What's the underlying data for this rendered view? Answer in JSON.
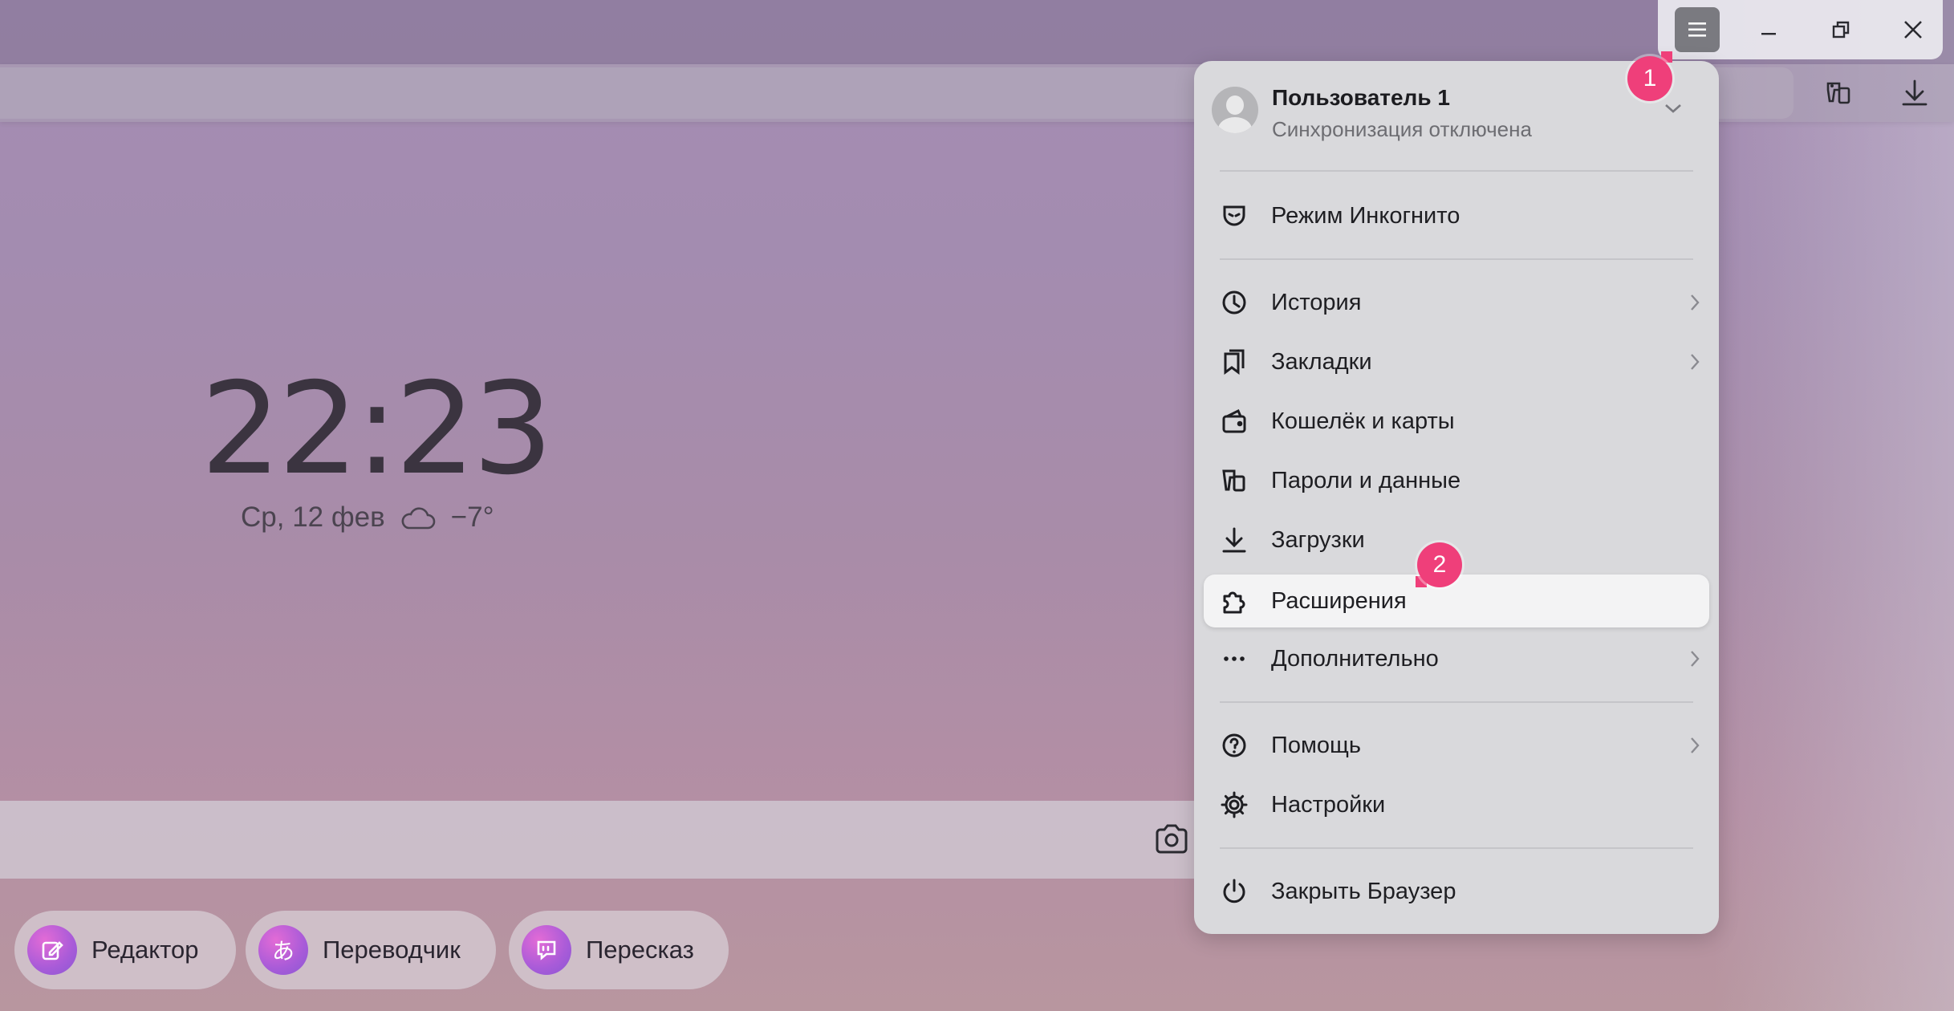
{
  "clock": {
    "hours": "22",
    "sep": ":",
    "minutes": "23"
  },
  "date": {
    "text": "Ср, 12 фев",
    "weather_icon": "cloud-icon",
    "temperature": "−7°"
  },
  "chips": [
    {
      "label": "Редактор",
      "icon": "editor-icon"
    },
    {
      "label": "Переводчик",
      "icon": "translator-icon",
      "glyph": "あ"
    },
    {
      "label": "Пересказ",
      "icon": "retell-icon"
    }
  ],
  "menu": {
    "user": {
      "name": "Пользователь 1",
      "status": "Синхронизация отключена"
    },
    "items": [
      {
        "label": "Режим Инкогнито",
        "icon": "incognito-mask-icon"
      },
      {
        "label": "История",
        "icon": "clock-icon",
        "submenu": true
      },
      {
        "label": "Закладки",
        "icon": "bookmarks-icon",
        "submenu": true
      },
      {
        "label": "Кошелёк и карты",
        "icon": "wallet-icon"
      },
      {
        "label": "Пароли и данные",
        "icon": "passwords-icon"
      },
      {
        "label": "Загрузки",
        "icon": "download-icon"
      },
      {
        "label": "Расширения",
        "icon": "puzzle-icon",
        "highlighted": true
      },
      {
        "label": "Дополнительно",
        "icon": "more-dots-icon",
        "submenu": true
      },
      {
        "label": "Помощь",
        "icon": "help-icon",
        "submenu": true
      },
      {
        "label": "Настройки",
        "icon": "gear-icon"
      },
      {
        "label": "Закрыть Браузер",
        "icon": "power-icon"
      }
    ]
  },
  "badges": {
    "first": "1",
    "second": "2"
  },
  "colors": {
    "badge": "#ef3f7a",
    "menu_bg": "#d9d9dc",
    "active_item": "#f3f3f4"
  }
}
